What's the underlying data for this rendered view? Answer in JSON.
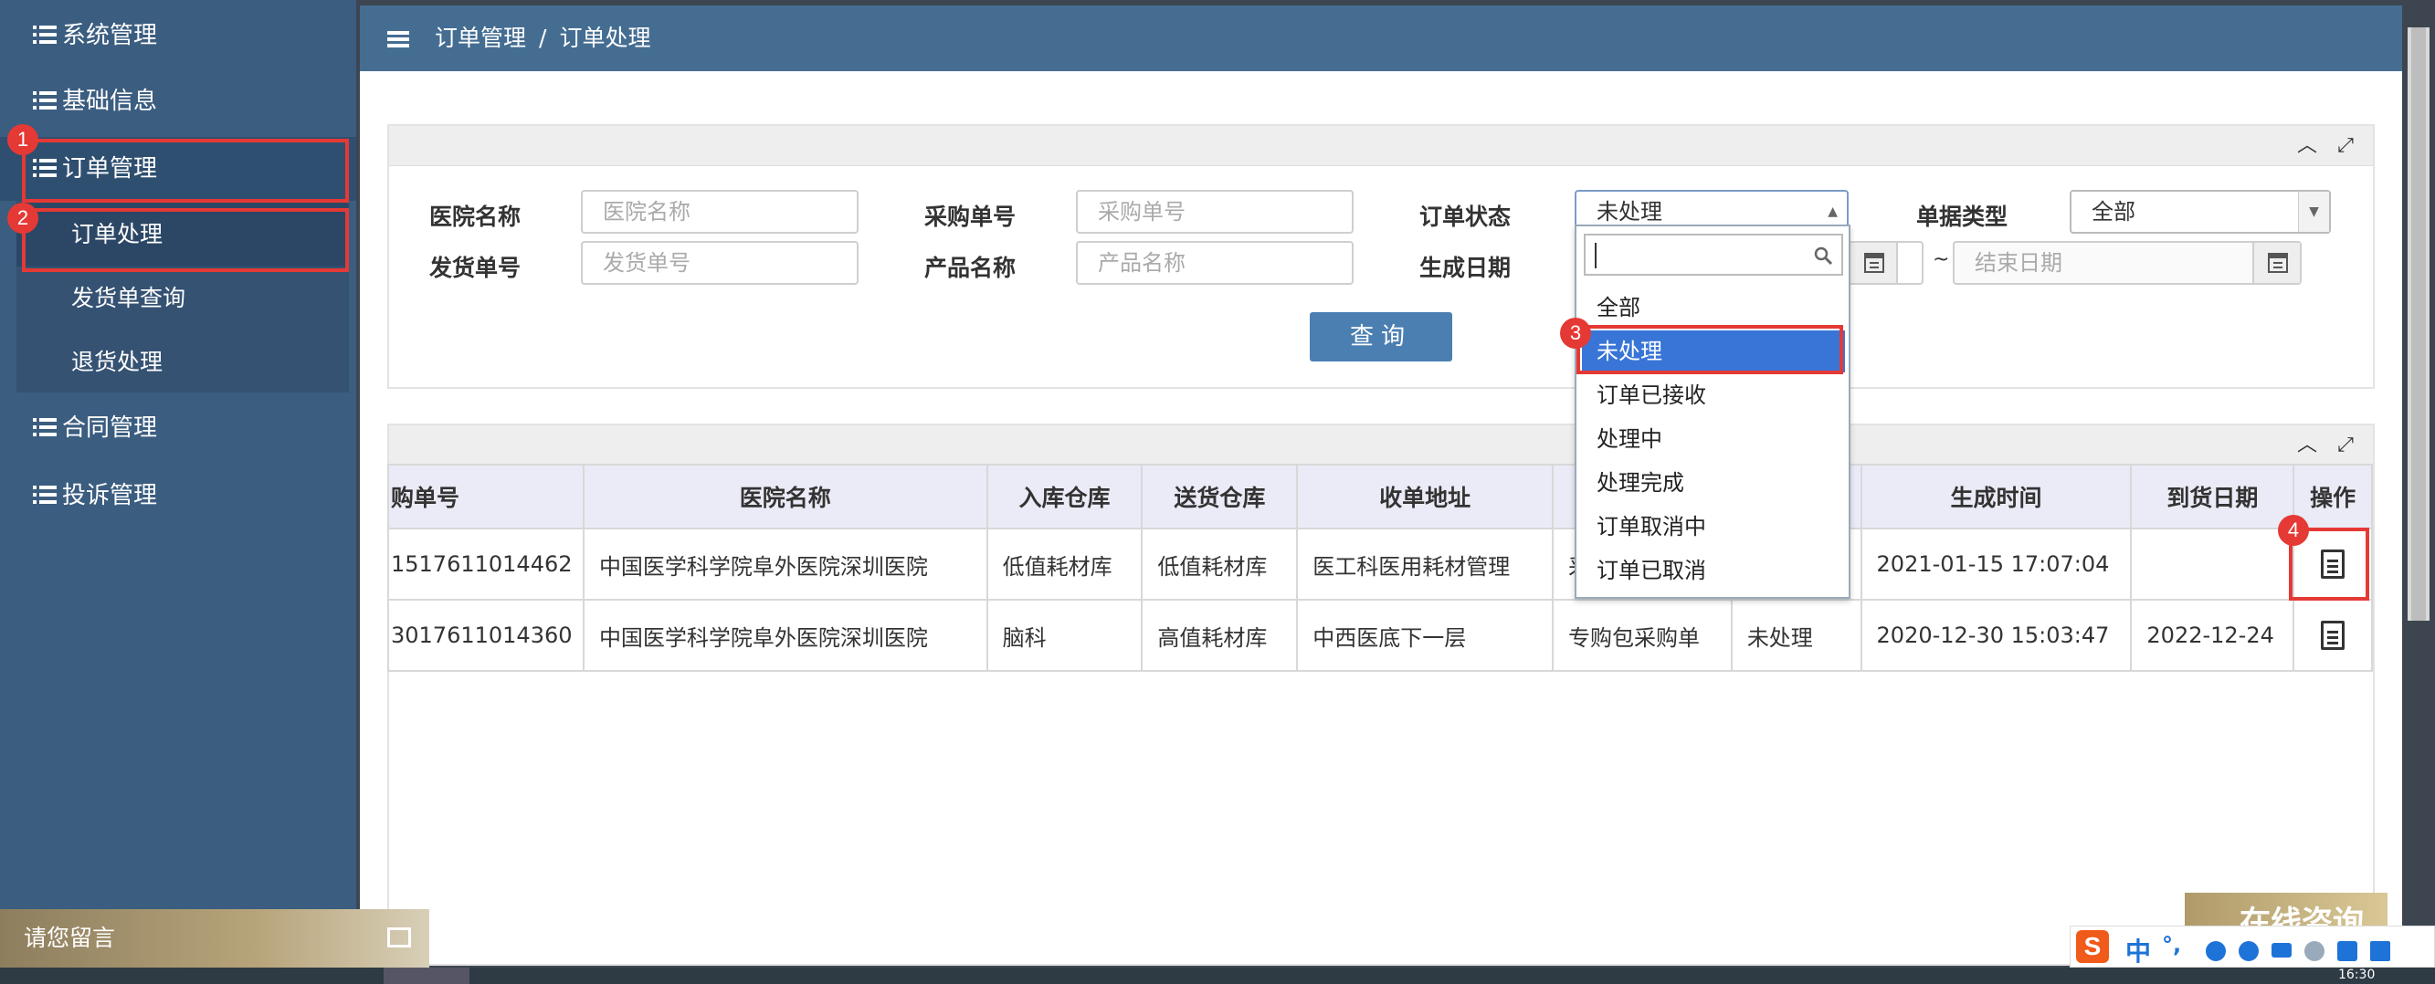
{
  "sidebar": {
    "items": [
      {
        "label": "系统管理"
      },
      {
        "label": "基础信息"
      },
      {
        "label": "订单管理"
      },
      {
        "label": "合同管理"
      },
      {
        "label": "投诉管理"
      }
    ],
    "sub_items": [
      {
        "label": "订单处理"
      },
      {
        "label": "发货单查询"
      },
      {
        "label": "退货处理"
      }
    ]
  },
  "markers": [
    "1",
    "2",
    "3",
    "4"
  ],
  "header": {
    "breadcrumb": [
      "订单管理",
      "订单处理"
    ],
    "separator": "/"
  },
  "form": {
    "hospital_label": "医院名称",
    "hospital_placeholder": "医院名称",
    "purchase_label": "采购单号",
    "purchase_placeholder": "采购单号",
    "status_label": "订单状态",
    "status_value": "未处理",
    "doctype_label": "单据类型",
    "doctype_value": "全部",
    "ship_label": "发货单号",
    "ship_placeholder": "发货单号",
    "product_label": "产品名称",
    "product_placeholder": "产品名称",
    "date_label": "生成日期",
    "date_tilde": "~",
    "end_date_placeholder": "结束日期",
    "query_button": "查询"
  },
  "dropdown": {
    "options": [
      "全部",
      "未处理",
      "订单已接收",
      "处理中",
      "处理完成",
      "订单取消中",
      "订单已取消"
    ],
    "selected_index": 1
  },
  "table": {
    "headers": [
      "购单号",
      "医院名称",
      "入库仓库",
      "送货仓库",
      "收单地址",
      "",
      "",
      "生成时间",
      "到货日期",
      "操作"
    ],
    "rows": [
      [
        "1517611014462",
        "中国医学科学院阜外医院深圳医院",
        "低值耗材库",
        "低值耗材库",
        "医工科医用耗材管理",
        "采",
        "",
        "2021-01-15 17:07:04",
        ""
      ],
      [
        "3017611014360",
        "中国医学科学院阜外医院深圳医院",
        "脑科",
        "高值耗材库",
        "中西医底下一层",
        "专购包采购单",
        "未处理",
        "2020-12-30 15:03:47",
        "2022-12-24"
      ]
    ]
  },
  "widgets": {
    "message_bar": "请您留言",
    "consult": "在线咨询",
    "ime_logo": "S",
    "ime_lang": "中",
    "ime_punct": "°,",
    "clock": "16:30"
  }
}
